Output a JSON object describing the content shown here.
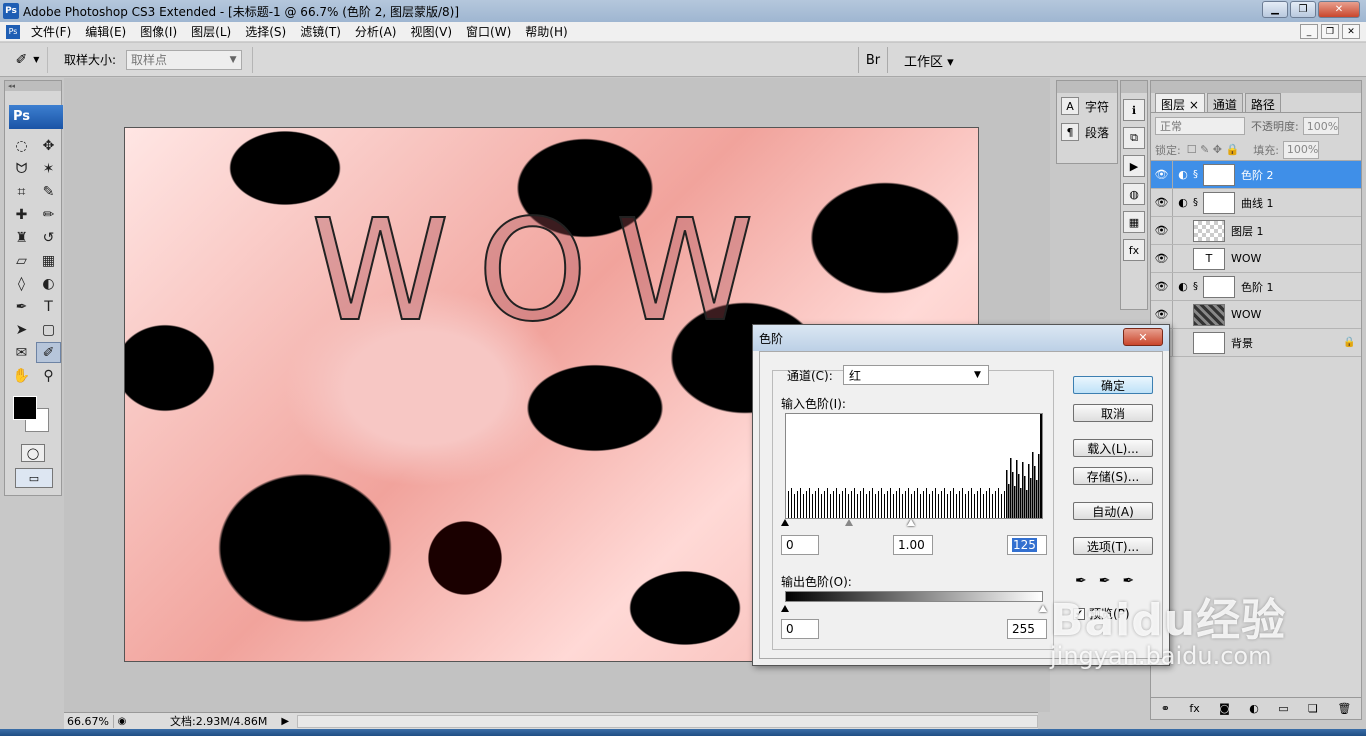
{
  "window": {
    "title": "Adobe Photoshop CS3 Extended - [未标题-1 @ 66.7% (色阶 2, 图层蒙版/8)]",
    "ps_logo": "Ps"
  },
  "menu": [
    "文件(F)",
    "编辑(E)",
    "图像(I)",
    "图层(L)",
    "选择(S)",
    "滤镜(T)",
    "分析(A)",
    "视图(V)",
    "窗口(W)",
    "帮助(H)"
  ],
  "options": {
    "sample_size_label": "取样大小:",
    "sample_size_value": "取样点",
    "workspace_label": "工作区"
  },
  "toolbox": {
    "badge": "Ps",
    "tools": [
      {
        "name": "marquee-tool",
        "glyph": "◌"
      },
      {
        "name": "move-tool",
        "glyph": "✥"
      },
      {
        "name": "lasso-tool",
        "glyph": "ᗢ"
      },
      {
        "name": "magic-wand-tool",
        "glyph": "✶"
      },
      {
        "name": "crop-tool",
        "glyph": "⌗"
      },
      {
        "name": "slice-tool",
        "glyph": "✎"
      },
      {
        "name": "healing-tool",
        "glyph": "✚"
      },
      {
        "name": "brush-tool",
        "glyph": "✏"
      },
      {
        "name": "stamp-tool",
        "glyph": "♜"
      },
      {
        "name": "history-brush-tool",
        "glyph": "↺"
      },
      {
        "name": "eraser-tool",
        "glyph": "▱"
      },
      {
        "name": "gradient-tool",
        "glyph": "▦"
      },
      {
        "name": "blur-tool",
        "glyph": "◊"
      },
      {
        "name": "dodge-tool",
        "glyph": "◐"
      },
      {
        "name": "pen-tool",
        "glyph": "✒"
      },
      {
        "name": "type-tool",
        "glyph": "T"
      },
      {
        "name": "path-select-tool",
        "glyph": "➤"
      },
      {
        "name": "shape-tool",
        "glyph": "▢"
      },
      {
        "name": "notes-tool",
        "glyph": "✉"
      },
      {
        "name": "eyedropper-tool",
        "glyph": "✐"
      },
      {
        "name": "hand-tool",
        "glyph": "✋"
      },
      {
        "name": "zoom-tool",
        "glyph": "⚲"
      }
    ]
  },
  "canvas": {
    "text": "WOW"
  },
  "status": {
    "zoom": "66.67%",
    "doc_size": "文档:2.93M/4.86M"
  },
  "side_panels": {
    "character_label": "字符",
    "paragraph_label": "段落"
  },
  "layers_panel": {
    "tabs": [
      "图层",
      "通道",
      "路径"
    ],
    "blend_mode": "正常",
    "opacity_label": "不透明度:",
    "opacity_value": "100%",
    "lock_label": "锁定:",
    "fill_label": "填充:",
    "fill_value": "100%",
    "layers": [
      {
        "name": "色阶 2",
        "selected": true
      },
      {
        "name": "曲线 1",
        "selected": false
      },
      {
        "name": "图层 1",
        "selected": false
      },
      {
        "name": "WOW",
        "selected": false
      },
      {
        "name": "色阶 1",
        "selected": false
      },
      {
        "name": "WOW",
        "selected": false
      },
      {
        "name": "背景",
        "selected": false
      }
    ]
  },
  "levels_dialog": {
    "title": "色阶",
    "channel_label": "通道(C):",
    "channel_value": "红",
    "input_label": "输入色阶(I):",
    "input_black": "0",
    "input_gamma": "1.00",
    "input_white": "125",
    "output_label": "输出色阶(O):",
    "output_black": "0",
    "output_white": "255",
    "buttons": {
      "ok": "确定",
      "cancel": "取消",
      "load": "载入(L)...",
      "save": "存储(S)...",
      "auto": "自动(A)",
      "options": "选项(T)..."
    },
    "preview_label": "预览(P)"
  },
  "watermark": {
    "brand": "Baidu经验",
    "url": "jingyan.baidu.com"
  }
}
